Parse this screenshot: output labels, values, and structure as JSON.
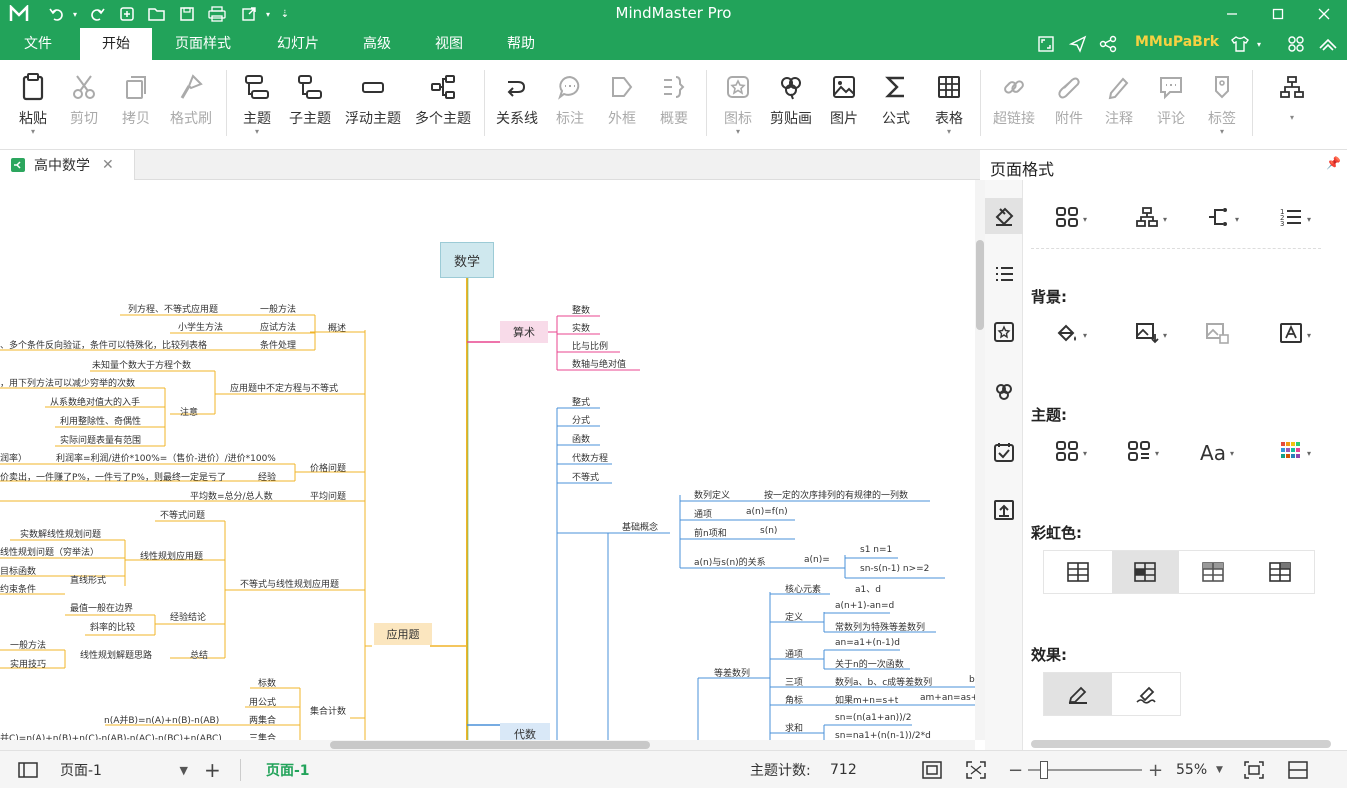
{
  "app": {
    "title": "MindMaster Pro",
    "user": "MMuPaBrk"
  },
  "menu": {
    "items": [
      "文件",
      "开始",
      "页面样式",
      "幻灯片",
      "高级",
      "视图",
      "帮助"
    ],
    "active": "开始"
  },
  "ribbon": {
    "paste": "粘贴",
    "cut": "剪切",
    "copy": "拷贝",
    "format_painter": "格式刷",
    "topic": "主题",
    "subtopic": "子主题",
    "floating_topic": "浮动主题",
    "multiple_topics": "多个主题",
    "relationship": "关系线",
    "callout": "标注",
    "boundary": "外框",
    "summary": "概要",
    "icon": "图标",
    "clipart": "剪贴画",
    "picture": "图片",
    "formula": "公式",
    "table": "表格",
    "hyperlink": "超链接",
    "attachment": "附件",
    "note": "注释",
    "comment": "评论",
    "tag": "标签"
  },
  "document": {
    "tab_title": "高中数学"
  },
  "mindmap": {
    "root": "数学",
    "main_branches": {
      "arithmetic": "算术",
      "word_problems": "应用题",
      "algebra": "代数"
    },
    "arithmetic_items": [
      "整数",
      "实数",
      "比与比例",
      "数轴与绝对值"
    ],
    "algebra_items": [
      "整式",
      "分式",
      "函数",
      "代数方程",
      "不等式"
    ],
    "seq_basic": "基础概念",
    "seq_def": "数列定义",
    "seq_def_val": "按一定的次序排列的有规律的一列数",
    "seq_general": "通项",
    "seq_general_val": "a(n)=f(n)",
    "seq_sum": "前n项和",
    "seq_sum_val": "s(n)",
    "seq_rel": "a(n)与s(n)的关系",
    "seq_rel_an": "a(n)=",
    "seq_rel_1": "s1  n=1",
    "seq_rel_2": "sn-s(n-1)    n>=2",
    "ap": "等差数列",
    "ap_core": "核心元素",
    "ap_core_val": "a1、d",
    "ap_def": "定义",
    "ap_def_1": "a(n+1)-an=d",
    "ap_def_2": "常数列为特殊等差数列",
    "ap_gen": "通项",
    "ap_gen_1": "an=a1+(n-1)d",
    "ap_gen_2": "关于n的一次函数",
    "ap_three": "三项",
    "ap_three_1": "数列a、b、c成等差数列",
    "ap_three_2": "b",
    "ap_idx": "角标",
    "ap_idx_1": "如果m+n=s+t",
    "ap_idx_2": "am+an=as+at",
    "ap_sum": "求和",
    "ap_sum_1": "sn=(n(a1+an))/2",
    "ap_sum_2": "sn=na1+(n(n-1))/2*d",
    "wp_overview": "概述",
    "wp_general": "一般方法",
    "wp_general_val": "列方程、不等式应用题",
    "wp_method": "应试方法",
    "wp_method_val": "小学生方法",
    "wp_cond": "条件处理",
    "wp_cond_val": "、多个条件反向验证，条件可以特殊化，比较列表格",
    "wp_uncertain": "应用题中不定方程与不等式",
    "wp_unk": "未知量个数大于方程个数",
    "wp_note": "注意",
    "wp_note_1": "，用下列方法可以减少穷举的次数",
    "wp_note_2": "从系数绝对值大的入手",
    "wp_note_3": "利用整除性、奇偶性",
    "wp_note_4": "实际问题表量有范围",
    "wp_price": "价格问题",
    "wp_price_1": "润率）",
    "wp_price_2": "利润率=利润/进价*100%=（售价-进价）/进价*100%",
    "wp_exp": "经验",
    "wp_exp_val": "价卖出，一件赚了P%，一件亏了P%，则最终一定是亏了",
    "wp_avg": "平均问题",
    "wp_avg_val": "平均数=总分/总人数",
    "wp_ineq": "不等式与线性规划应用题",
    "wp_ineq_prob": "不等式问题",
    "wp_lp": "线性规划应用题",
    "wp_lp_1": "实数解线性规划问题",
    "wp_lp_2": "线性规划问题（穷举法）",
    "wp_lp_3": "目标函数",
    "wp_lp_4": "约束条件",
    "wp_line": "直线形式",
    "wp_conc": "经验结论",
    "wp_conc_1": "最值一般在边界",
    "wp_conc_2": "斜率的比较",
    "wp_sum": "总结",
    "wp_sum_1": "一般方法",
    "wp_sum_2": "实用技巧",
    "wp_sum_3": "线性规划解题思路",
    "wp_set": "集合计数",
    "wp_set_1": "标数",
    "wp_set_2": "用公式",
    "wp_set_3": "两集合",
    "wp_set_3v": "n(A并B)=n(A)+n(B)-n(AB)",
    "wp_set_4": "三集合",
    "wp_set_4v": "并C)=n(A)+n(B)+n(C)-n(AB)-n(AC)-n(BC)+n(ABC)"
  },
  "panel": {
    "title": "页面格式",
    "background": "背景:",
    "theme": "主题:",
    "rainbow": "彩虹色:",
    "effects": "效果:"
  },
  "status": {
    "page_select": "页面-1",
    "page_tab": "页面-1",
    "topic_count_label": "主题计数:",
    "topic_count": "712",
    "zoom": "55%"
  },
  "colors": {
    "accent": "#22a35a",
    "arith_branch": "#e9468f",
    "word_branch": "#f0b429",
    "algebra_branch": "#4a90d9"
  }
}
